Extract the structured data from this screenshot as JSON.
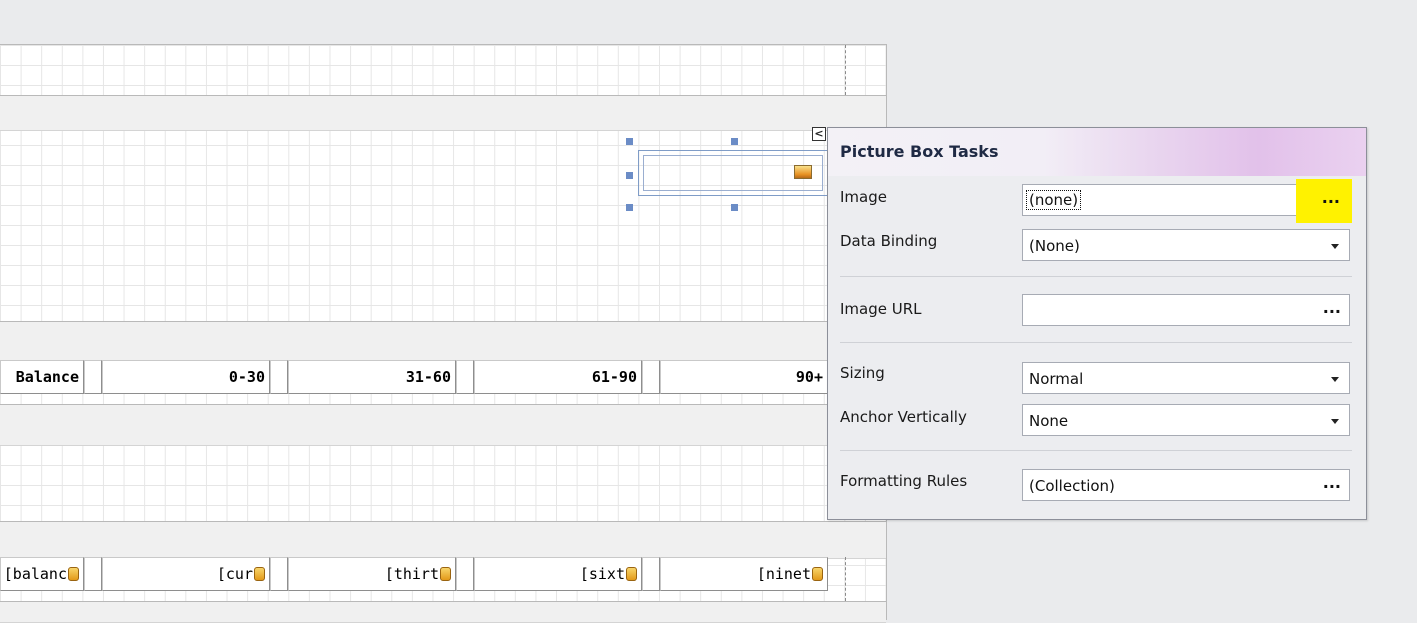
{
  "report": {
    "header_row": {
      "balance": "Balance",
      "col_0_30": "0-30",
      "col_31_60": "31-60",
      "col_61_90": "61-90",
      "col_90_plus": "90+"
    },
    "detail_row": {
      "balance": "[balanc",
      "current": "[cur",
      "thirty": "[thirt",
      "sixty": "[sixt",
      "ninety": "[ninet"
    }
  },
  "task_panel": {
    "title": "Picture Box Tasks",
    "image": {
      "label": "Image",
      "value": "(none)",
      "button": "..."
    },
    "data_binding": {
      "label": "Data Binding",
      "value": "(None)"
    },
    "image_url": {
      "label": "Image URL",
      "value": "",
      "button": "..."
    },
    "sizing": {
      "label": "Sizing",
      "value": "Normal"
    },
    "anchor_vertically": {
      "label": "Anchor Vertically",
      "value": "None"
    },
    "formatting_rules": {
      "label": "Formatting Rules",
      "value": "(Collection)",
      "button": "..."
    }
  },
  "smart_tag_glyph": "<",
  "colors": {
    "highlight": "#fff200",
    "handle": "#6b8cc6"
  }
}
